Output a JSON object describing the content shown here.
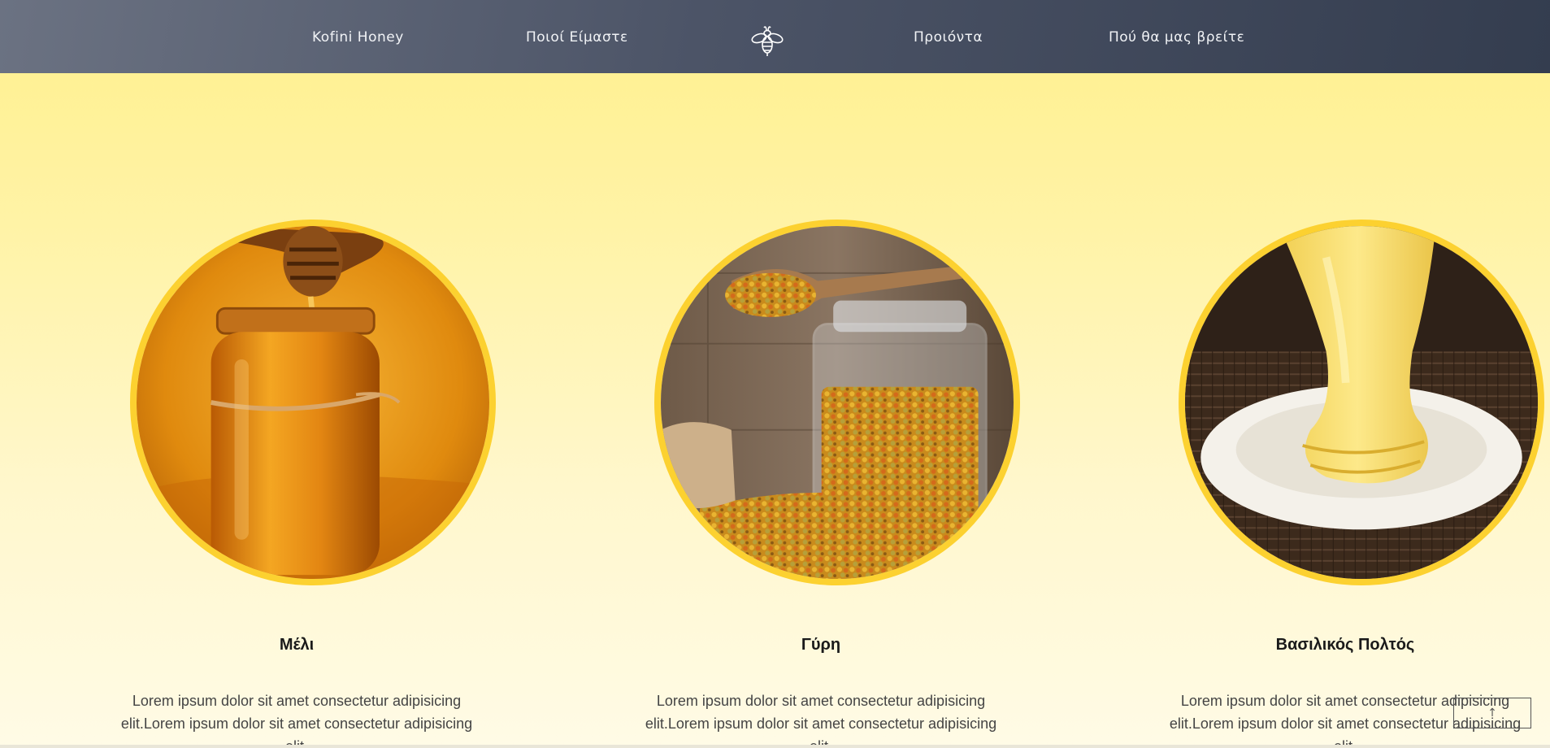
{
  "nav": {
    "links": [
      "Kofini Honey",
      "Ποιοί Είμαστε",
      "Προιόντα",
      "Πού θα μας βρείτε"
    ],
    "logo_icon": "bee-icon"
  },
  "products": [
    {
      "title": "Μέλι",
      "description": "Lorem ipsum dolor sit amet consectetur adipisicing elit.Lorem ipsum dolor sit amet consectetur adipisicing elit.",
      "image": "honey-jar-image"
    },
    {
      "title": "Γύρη",
      "description": "Lorem ipsum dolor sit amet consectetur adipisicing elit.Lorem ipsum dolor sit amet consectetur adipisicing elit.",
      "image": "pollen-jar-image"
    },
    {
      "title": "Βασιλικός Πολτός",
      "description": "Lorem ipsum dolor sit amet consectetur adipisicing elit.Lorem ipsum dolor sit amet consectetur adipisicing elit.",
      "image": "royal-jelly-image"
    }
  ],
  "back_to_top": {
    "label": "↑",
    "icon": "arrow-up-icon"
  },
  "colors": {
    "accent": "#fcd130",
    "nav_bg": "#4c5467",
    "bg_top": "#fff08c",
    "bg_bottom": "#fffbe6"
  }
}
